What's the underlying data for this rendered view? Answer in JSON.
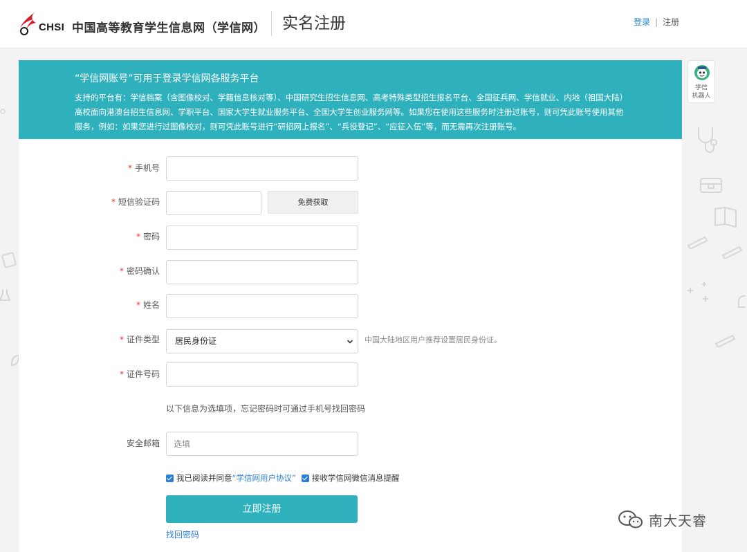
{
  "header": {
    "logo_text": "CHSI",
    "site_name": "中国高等教育学生信息网（学信网）",
    "page_title": "实名注册",
    "login_link": "登录",
    "link_separator": "|",
    "register_link": "注册"
  },
  "banner": {
    "title": "“学信网账号”可用于登录学信网各服务平台",
    "description": "支持的平台有：学信档案（含图像校对、学籍信息核对等）、中国研究生招生信息网、高考特殊类型招生报名平台、全国征兵网、学信就业、内地（祖国大陆）高校面向港澳台招生信息网、学职平台、国家大学生就业服务平台、全国大学生创业服务网等。如果您在使用这些服务时注册过账号，则可凭此账号使用其他服务，例如：如果您进行过图像校对，则可凭此账号进行“研招网上报名”、“兵役登记”、“应征入伍”等，而无需再次注册账号。"
  },
  "form": {
    "required_mark": "*",
    "phone_label": "手机号",
    "phone_value": "",
    "sms_label": "短信验证码",
    "sms_value": "",
    "sms_button": "免费获取",
    "password_label": "密码",
    "password_confirm_label": "密码确认",
    "name_label": "姓名",
    "id_type_label": "证件类型",
    "id_type_selected": "居民身份证",
    "id_type_hint": "中国大陆地区用户推荐设置居民身份证。",
    "id_number_label": "证件号码",
    "optional_note": "以下信息为选填项，忘记密码时可通过手机号找回密码",
    "email_label": "安全邮箱",
    "email_placeholder": "选填",
    "agree_text": "我已阅读并同意",
    "agree_link": "“学信网用户协议”",
    "agree_checked": true,
    "wechat_text": "接收学信网微信消息提醒",
    "wechat_checked": true,
    "submit_button": "立即注册",
    "recover_link": "找回密码"
  },
  "robot": {
    "label_line1": "学信",
    "label_line2": "机器人",
    "icon": "robot-icon"
  },
  "watermark": {
    "icon": "wechat-icon",
    "text": "南大天睿"
  },
  "colors": {
    "accent": "#2fb1bd",
    "link": "#2a7fd4",
    "required": "#e2382c",
    "logo_red": "#d3202a"
  }
}
